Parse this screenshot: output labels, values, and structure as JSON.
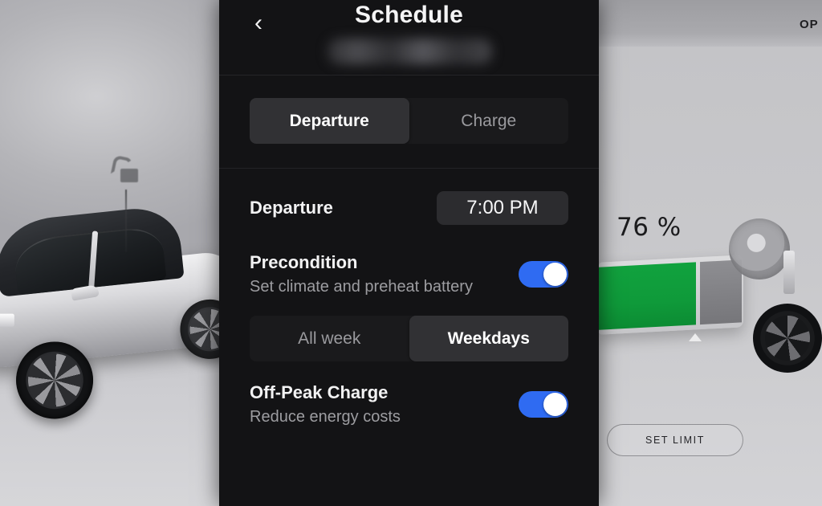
{
  "panel": {
    "header": {
      "title": "Schedule",
      "back_icon": "chevron-left-icon",
      "subtitle_redacted": ""
    },
    "mode_tabs": [
      {
        "label": "Departure",
        "selected": true
      },
      {
        "label": "Charge",
        "selected": false
      }
    ],
    "departure": {
      "label": "Departure",
      "time_value": "7:00 PM"
    },
    "precondition": {
      "title": "Precondition",
      "subtitle": "Set climate and preheat battery",
      "toggle_state": "on"
    },
    "day_tabs": [
      {
        "label": "All week",
        "selected": false
      },
      {
        "label": "Weekdays",
        "selected": true
      }
    ],
    "off_peak": {
      "title": "Off-Peak Charge",
      "subtitle": "Reduce energy costs",
      "toggle_state": "on"
    }
  },
  "background": {
    "battery_percent_label": "76 %",
    "set_limit_label": "SET LIMIT",
    "top_right_label": "OP",
    "lock_icon": "unlock-icon",
    "car_image_alt": "white-car-illustration"
  },
  "colors": {
    "toggle_on": "#2f6bf2",
    "panel_background": "#131315",
    "segment_selected": "#313134",
    "battery_fill_green": "#11a23e",
    "accent_text": "#ffffff"
  }
}
